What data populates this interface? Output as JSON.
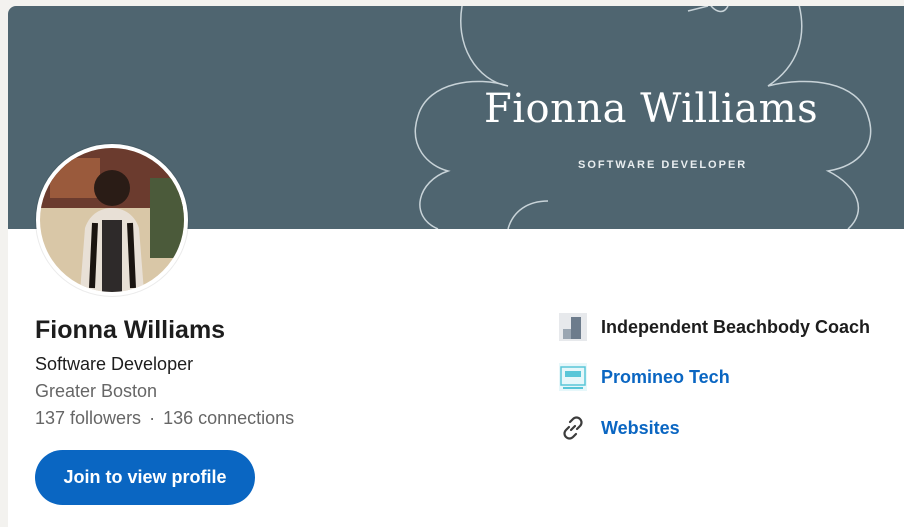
{
  "banner": {
    "name": "Fionna Williams",
    "subtitle": "SOFTWARE DEVELOPER",
    "background_color": "#4f6570"
  },
  "profile": {
    "name": "Fionna Williams",
    "headline": "Software Developer",
    "location": "Greater Boston",
    "followers": "137 followers",
    "separator": "·",
    "connections": "136 connections",
    "join_label": "Join to view profile",
    "accent_color": "#0a66c2"
  },
  "sidebar": {
    "items": [
      {
        "label": "Independent Beachbody Coach",
        "icon": "company-logo-icon"
      },
      {
        "label": "Promineo Tech",
        "icon": "school-logo-icon"
      },
      {
        "label": "Websites",
        "icon": "link-icon"
      }
    ]
  }
}
